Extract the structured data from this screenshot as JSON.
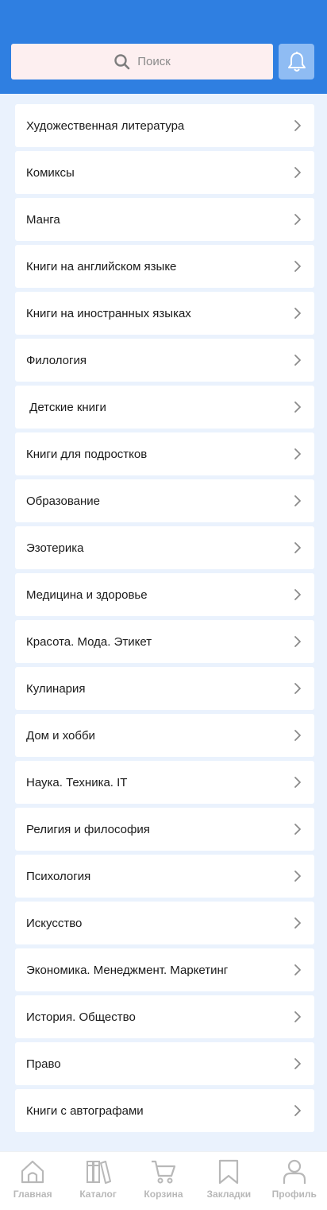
{
  "search": {
    "placeholder": "Поиск",
    "icon": "search-icon"
  },
  "notifications": {
    "icon": "bell-icon"
  },
  "categories": [
    "Художественная литература",
    "Комиксы",
    "Манга",
    "Книги на английском языке",
    "Книги на иностранных языках",
    "Филология",
    " Детские книги",
    "Книги для подростков",
    "Образование",
    "Эзотерика",
    "Медицина и здоровье",
    "Красота. Мода. Этикет",
    "Кулинария",
    "Дом и хобби",
    "Наука. Техника. IT",
    "Религия и философия",
    "Психология",
    "Искусство",
    "Экономика. Менеджмент. Маркетинг",
    "История. Общество",
    "Право",
    "Книги с автографами"
  ],
  "bottom_nav": [
    {
      "label": "Главная",
      "icon": "home-icon"
    },
    {
      "label": "Каталог",
      "icon": "books-icon"
    },
    {
      "label": "Корзина",
      "icon": "cart-icon"
    },
    {
      "label": "Закладки",
      "icon": "bookmark-icon"
    },
    {
      "label": "Профиль",
      "icon": "profile-icon"
    }
  ],
  "colors": {
    "header": "#2f7fe1",
    "search_bg": "#fdeff0",
    "bell_bg": "#8fbcf3",
    "page_bg": "#eaf2fd",
    "nav_inactive": "#b8b8b8"
  }
}
